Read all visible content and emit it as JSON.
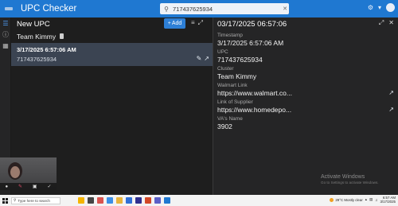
{
  "app": {
    "title": "UPC Checker",
    "search": {
      "value": "717437625934",
      "placeholder": "Search"
    }
  },
  "rail": {
    "items": [
      {
        "icon": "list-icon",
        "active": true
      },
      {
        "icon": "info-icon",
        "active": false
      },
      {
        "icon": "grid-icon",
        "active": false
      }
    ]
  },
  "list_panel": {
    "title": "New UPC",
    "add_label": "Add",
    "cluster_name": "Team Kimmy",
    "entries": [
      {
        "timestamp": "3/17/2025 6:57:06 AM",
        "upc": "717437625934",
        "selected": true
      }
    ]
  },
  "detail_panel": {
    "title": "03/17/2025 06:57:06",
    "fields": [
      {
        "label": "Timestamp",
        "value": "3/17/2025 6:57:06 AM",
        "link": false
      },
      {
        "label": "UPC",
        "value": "717437625934",
        "link": false
      },
      {
        "label": "Cluster",
        "value": "Team Kimmy",
        "link": false
      },
      {
        "label": "Walmart Link",
        "value": "https://www.walmart.co...",
        "link": true
      },
      {
        "label": "Link of Supplier",
        "value": "https://www.homedepo...",
        "link": true
      },
      {
        "label": "VA's Name",
        "value": "3902",
        "link": false
      }
    ]
  },
  "watermark": {
    "line1": "Activate Windows",
    "line2": "Go to Settings to activate Windows."
  },
  "taskbar": {
    "search_placeholder": "Type here to search",
    "weather": "29°C Mostly clear",
    "time": "6:57 AM",
    "date": "3/17/2025"
  },
  "colors": {
    "app_bar": "#1f78d1",
    "selected_row": "#3b4452",
    "accent_button": "#2d7fd6"
  }
}
